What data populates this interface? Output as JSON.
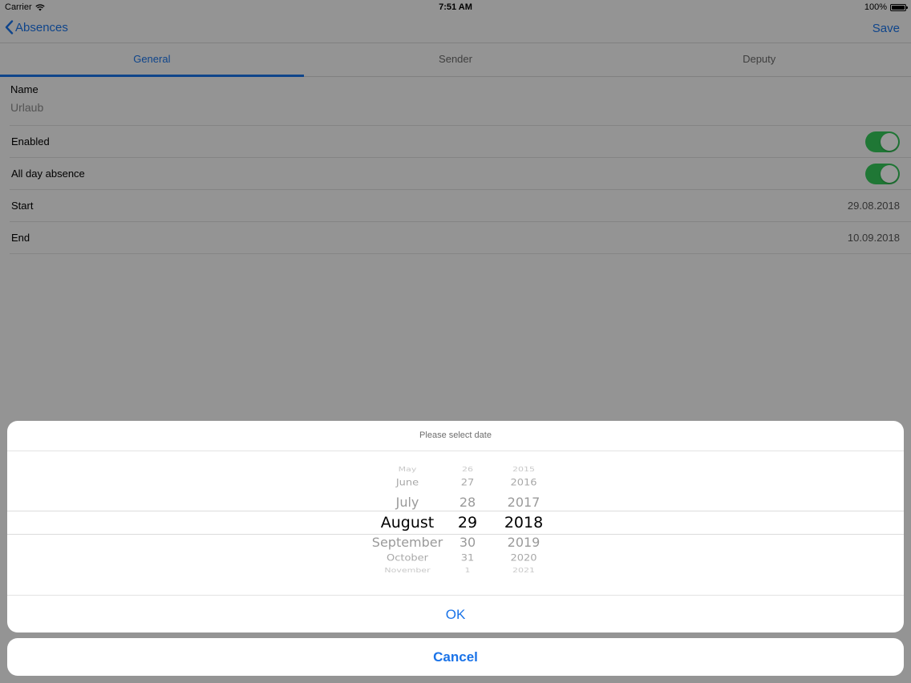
{
  "status": {
    "carrier": "Carrier",
    "wifi_icon": "wifi-icon",
    "time": "7:51 AM",
    "battery": "100%",
    "battery_icon": "battery-icon"
  },
  "nav": {
    "back_icon": "chevron-left-icon",
    "back_label": "Absences",
    "save_label": "Save"
  },
  "tabs": [
    {
      "label": "General",
      "active": true
    },
    {
      "label": "Sender",
      "active": false
    },
    {
      "label": "Deputy",
      "active": false
    }
  ],
  "form": {
    "name_label": "Name",
    "name_value": "Urlaub",
    "enabled_label": "Enabled",
    "enabled_on": true,
    "allday_label": "All day absence",
    "allday_on": true,
    "start_label": "Start",
    "start_value": "29.08.2018",
    "end_label": "End",
    "end_value": "10.09.2018"
  },
  "date_picker": {
    "title": "Please select date",
    "months": [
      "May",
      "June",
      "July",
      "August",
      "September",
      "October",
      "November"
    ],
    "days": [
      "26",
      "27",
      "28",
      "29",
      "30",
      "31",
      "1"
    ],
    "years": [
      "2015",
      "2016",
      "2017",
      "2018",
      "2019",
      "2020",
      "2021"
    ],
    "selected": {
      "month": "August",
      "day": "29",
      "year": "2018"
    },
    "ok_label": "OK",
    "cancel_label": "Cancel"
  },
  "colors": {
    "accent": "#1a73e8",
    "toggle_on": "#34c759"
  }
}
